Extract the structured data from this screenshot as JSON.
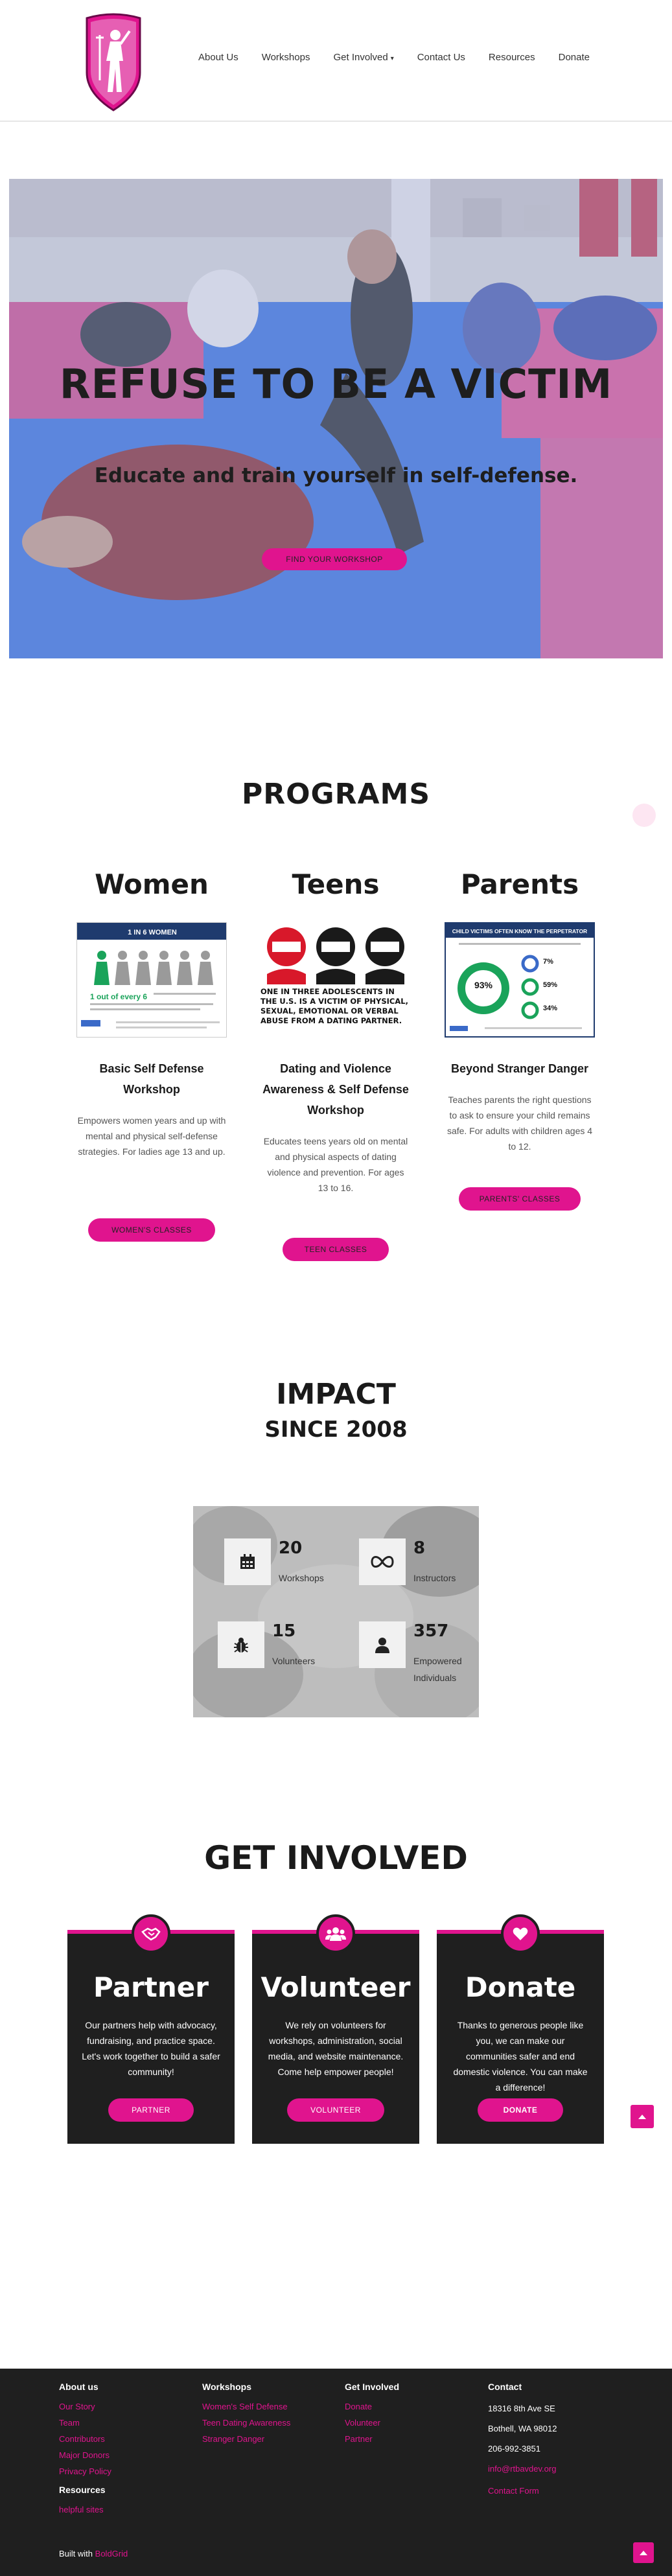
{
  "colors": {
    "accent": "#e0148e",
    "dark": "#1f1f1f",
    "hero_tint": "#9eb2e8"
  },
  "nav": {
    "items": [
      "About Us",
      "Workshops",
      "Get Involved",
      "Contact Us",
      "Resources",
      "Donate"
    ]
  },
  "hero": {
    "title": "REFUSE TO BE A VICTIM",
    "subtitle": "Educate and train yourself in self-defense.",
    "button": "FIND YOUR WORKSHOP"
  },
  "programs": {
    "title": "PROGRAMS",
    "items": [
      {
        "name": "Women",
        "image_caption": "1 IN 6 WOMEN",
        "image_stat": "1 out of every 6",
        "heading": "Basic Self Defense Workshop",
        "description": "Empowers women years and up with mental and physical self-defense strategies.  For ladies age 13 and up.",
        "button": "WOMEN'S CLASSES"
      },
      {
        "name": "Teens",
        "image_caption": "ONE IN THREE ADOLESCENTS IN THE U.S. IS A VICTIM OF PHYSICAL, SEXUAL, EMOTIONAL OR VERBAL ABUSE FROM A DATING PARTNER.",
        "heading": "Dating and Violence Awareness & Self Defense Workshop",
        "description": "Educates teens years old on mental and physical aspects of dating violence and prevention. For ages 13 to 16.",
        "button": "TEEN CLASSES"
      },
      {
        "name": "Parents",
        "image_caption": "CHILD VICTIMS OFTEN KNOW THE PERPETRATOR",
        "image_stats": [
          "93%",
          "7%",
          "59%",
          "34%"
        ],
        "heading": "Beyond Stranger Danger",
        "description": "Teaches parents the right questions to ask to ensure your child remains safe. For adults with children ages 4 to 12.",
        "button": "PARENTS' CLASSES"
      }
    ]
  },
  "impact": {
    "title": "IMPACT",
    "subtitle": "SINCE 2008",
    "stats": [
      {
        "value": "20",
        "label": "Workshops",
        "icon": "calendar-icon"
      },
      {
        "value": "8",
        "label": "Instructors",
        "icon": "infinity-icon"
      },
      {
        "value": "15",
        "label": "Volunteers",
        "icon": "bug-icon"
      },
      {
        "value": "357",
        "label": "Empowered Individuals",
        "icon": "user-icon"
      }
    ]
  },
  "involved": {
    "title": "GET INVOLVED",
    "cards": [
      {
        "title": "Partner",
        "text": "Our partners help with advocacy, fundraising, and practice space. Let's work together to build a safer community!",
        "button": "PARTNER",
        "icon": "handshake-icon"
      },
      {
        "title": "Volunteer",
        "text": "We rely on volunteers for workshops, administration, social media, and website maintenance. Come help empower people!",
        "button": "VOLUNTEER",
        "icon": "users-icon"
      },
      {
        "title": "Donate",
        "text": "Thanks to generous people like you, we can make our communities safer and end domestic violence. You can make a difference!",
        "button": "DONATE",
        "icon": "heart-icon"
      }
    ]
  },
  "footer": {
    "about": {
      "heading": "About us",
      "links": [
        "Our Story",
        "Team",
        "Contributors",
        "Major Donors",
        "Privacy Policy"
      ]
    },
    "resources": {
      "heading": "Resources",
      "links": [
        "helpful sites"
      ]
    },
    "workshops": {
      "heading": "Workshops",
      "links": [
        "Women's Self Defense",
        "Teen Dating Awareness",
        "Stranger Danger"
      ]
    },
    "involved": {
      "heading": "Get Involved",
      "links": [
        "Donate",
        "Volunteer",
        "Partner"
      ]
    },
    "contact": {
      "heading": "Contact",
      "address1": "18316 8th Ave SE",
      "address2": "Bothell, WA 98012",
      "phone": "206-992-3851",
      "email": "info@rtbavdev.org",
      "form": "Contact Form"
    },
    "built_prefix": "Built with",
    "built_link": "BoldGrid"
  }
}
